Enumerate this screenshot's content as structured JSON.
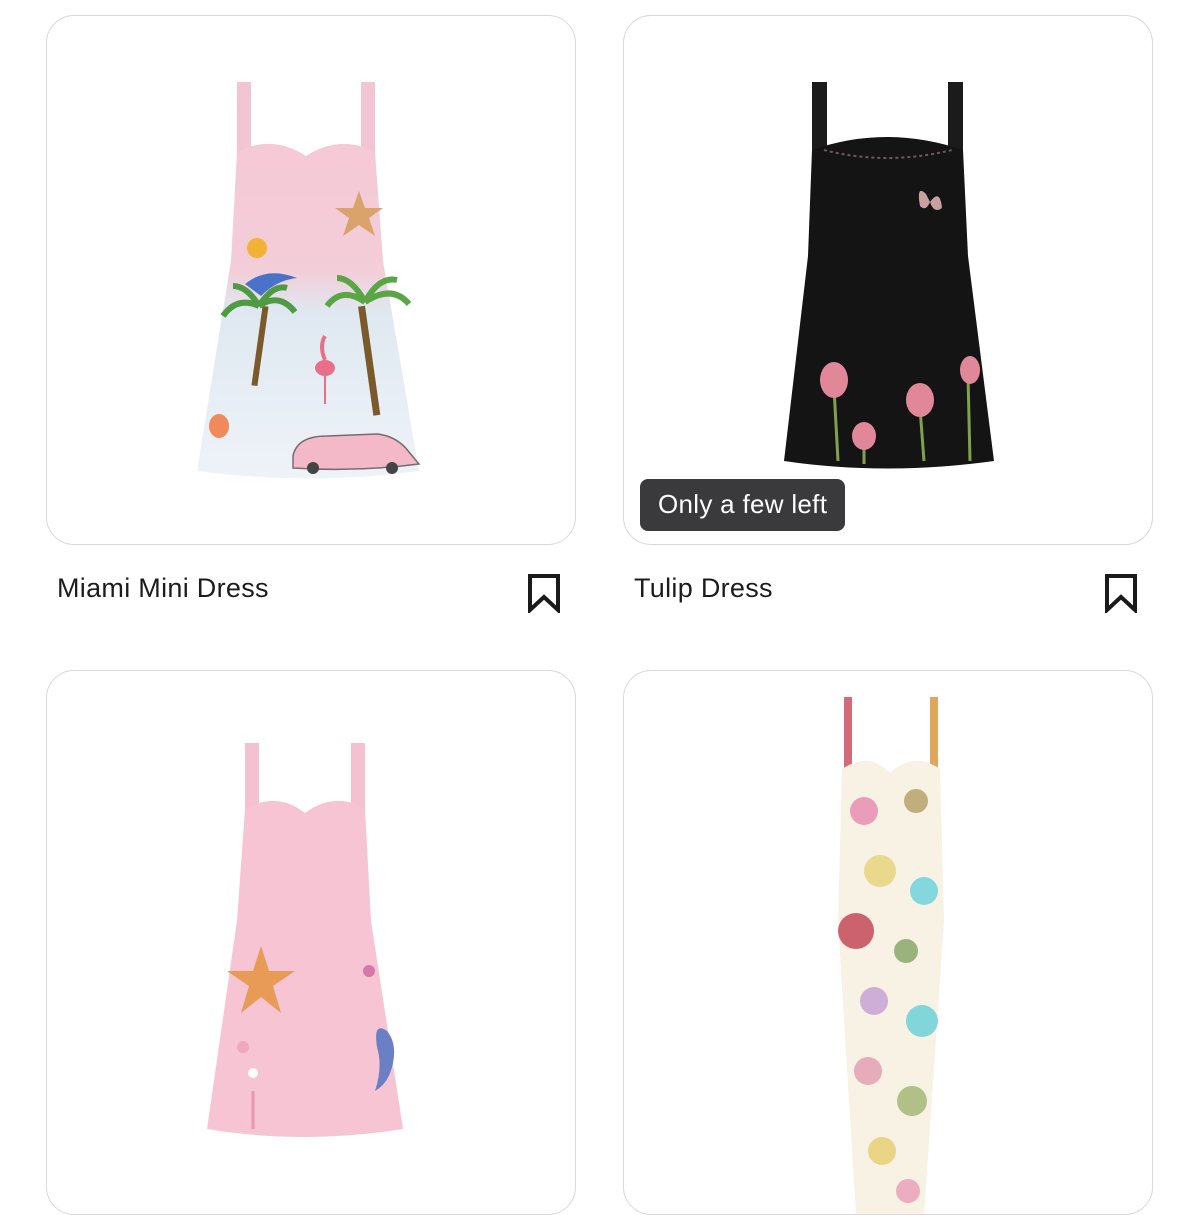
{
  "products": [
    {
      "name": "Miami Mini Dress",
      "badge": "",
      "image": "pink-mini-dress-with-palm-tree-flamingo-embroidery",
      "bookmark_icon": "bookmark-icon"
    },
    {
      "name": "Tulip Dress",
      "badge": "Only a few left",
      "image": "black-sequin-mini-dress-with-tulip-embroidery",
      "bookmark_icon": "bookmark-icon"
    },
    {
      "name": "",
      "badge": "",
      "image": "pink-mini-dress-with-starfish-seahorse-embroidery",
      "bookmark_icon": ""
    },
    {
      "name": "",
      "badge": "",
      "image": "ivory-floral-slip-midi-dress",
      "bookmark_icon": ""
    }
  ],
  "colors": {
    "card_border": "#d9d9d9",
    "badge_bg": "#3a3a3c",
    "text": "#1c1c1c"
  }
}
